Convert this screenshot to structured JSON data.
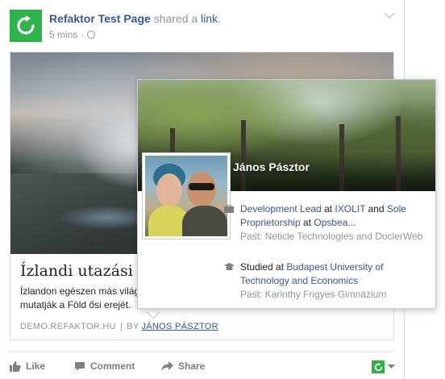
{
  "post": {
    "page_name": "Refaktor Test Page",
    "shared_text": " shared a ",
    "link_word": "link",
    "period": ".",
    "timestamp": "5 mins",
    "meta_sep": "·",
    "colors": {
      "brand_green": "#2db34a",
      "link_blue": "#365899",
      "muted": "#90949c"
    }
  },
  "link_card": {
    "title": "Ízlandi utazási tipp",
    "description": "Ízlandon egészen más világ mutatják a Föld ősi erejét.",
    "source": "DEMO.REFAKTOR.HU",
    "separator": "|",
    "by_label": "BY",
    "author": "JÁNOS PÁSZTOR"
  },
  "actions": {
    "like": "Like",
    "comment": "Comment",
    "share": "Share"
  },
  "hovercard": {
    "name": "János Pásztor",
    "work": {
      "role": "Development Lead",
      "at1": " at ",
      "company1": "IXOLIT",
      "and": " and ",
      "role2": "Sole Proprietorship",
      "at2": " at ",
      "company2": "Opsbea...",
      "past": "Past: Neticle Technologies and DoclerWeb"
    },
    "education": {
      "studied_at": "Studied at ",
      "school": "Budapest University of Technology and Economics",
      "past": "Past: Karinthy Frigyes Gimnázium"
    }
  }
}
